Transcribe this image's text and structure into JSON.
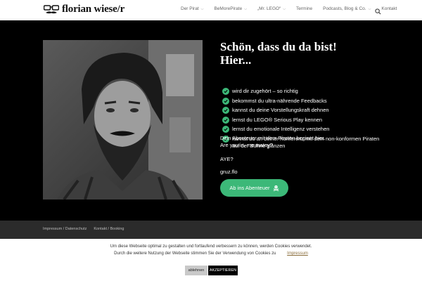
{
  "header": {
    "logo_text": "florian wiese/r",
    "logo_icon": "glasses-mustache-icon",
    "nav": [
      {
        "label": "Der Pirat",
        "dropdown": true
      },
      {
        "label": "BeMorePirate",
        "dropdown": true
      },
      {
        "label": "„Mr. LEGO“",
        "dropdown": true
      },
      {
        "label": "Termine",
        "dropdown": false
      },
      {
        "label": "Podcasts, Blog & Co.",
        "dropdown": true
      },
      {
        "label": "Kontakt",
        "dropdown": false
      }
    ],
    "search_icon": "search-icon"
  },
  "hero": {
    "headline_line1": "Schön, dass du da bist!",
    "headline_line2": "Hier...",
    "bullets": [
      "wird dir zugehört – so richtig",
      "bekommst du ultra-nährende Feedbacks",
      "kannst du deine Vorstellungskraft dehnen",
      "lernst du LEGO® Serious Play kennen",
      "lernst du emotionale Intelligenz verstehen",
      "kannst du an deiner Konferenz mit dem non-konformen Piraten auf der Bühne glänzen"
    ],
    "intro_line1": "Dein Abenteuer mit dem Piraten beginnt hier.",
    "intro_line2": "Are you in, me matey?",
    "aye": "AYE?",
    "signoff": "gruz.flo",
    "cta_label": "Ab ins Abenteuer",
    "cta_icon": "skull-crossbones-icon",
    "accent_color": "#3cb878"
  },
  "footer": {
    "link1": "Impressum / Datenschutz",
    "link2": "Kontakt / Booking"
  },
  "cookie": {
    "line1": "Um diese Webseite optimal zu gestalten und fortlaufend verbessern zu können, werden Cookies verwendet.",
    "line2": "Durch die weitere Nutzung der Webseite stimmen Sie der Verwendung von Cookies zu",
    "link": "Impressum",
    "decline": "ablehnen",
    "accept": "AKZEPTIEREN"
  }
}
